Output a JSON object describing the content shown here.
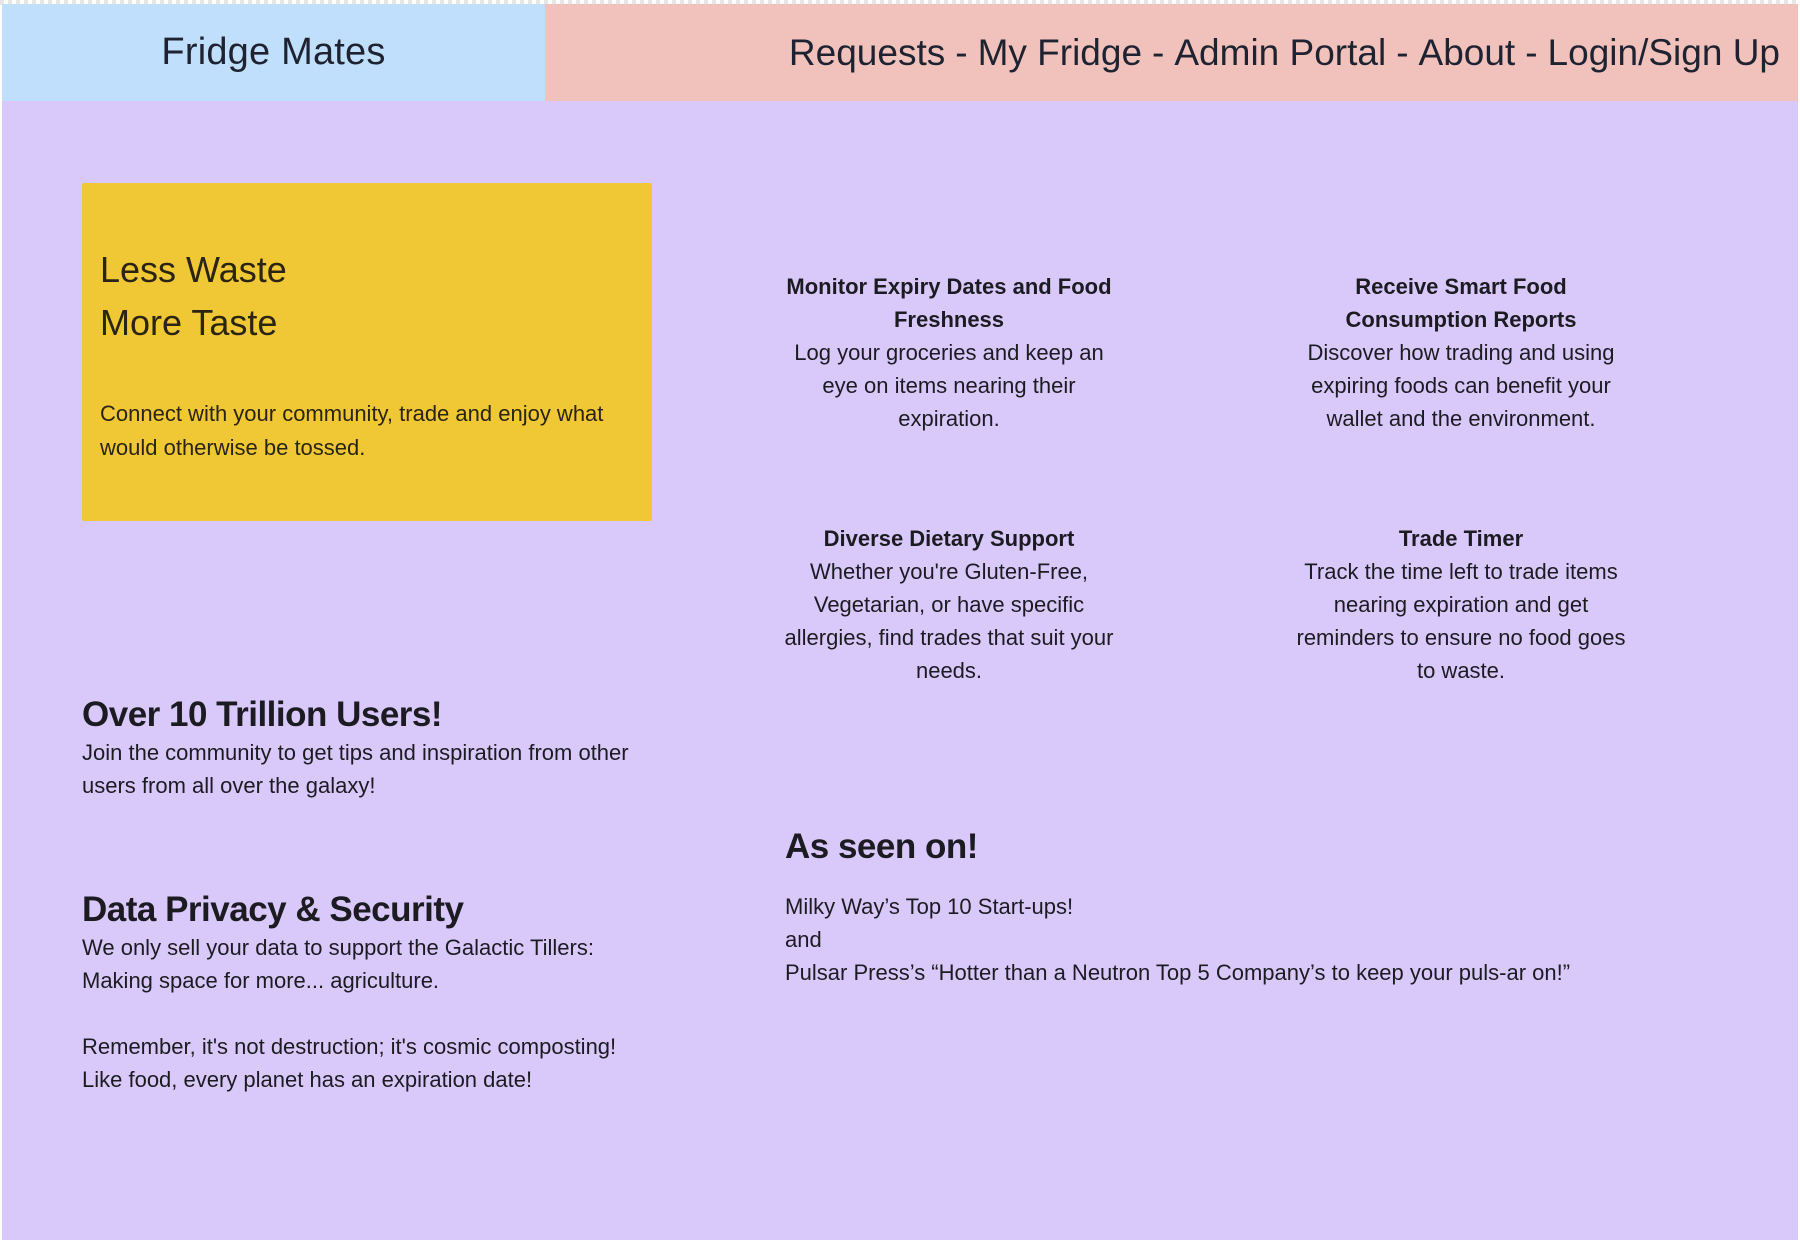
{
  "header": {
    "brand": "Fridge Mates",
    "nav": [
      {
        "label": "Requests"
      },
      {
        "label": "My Fridge"
      },
      {
        "label": "Admin Portal"
      },
      {
        "label": "About"
      },
      {
        "label": "Login/Sign Up"
      }
    ],
    "separator": "-"
  },
  "hero": {
    "line1": "Less Waste",
    "line2": "More Taste",
    "text": "Connect with your community, trade and enjoy what would otherwise be tossed."
  },
  "features": [
    {
      "title": "Monitor Expiry Dates and Food Freshness",
      "text": "Log your groceries and keep an eye on items nearing their expiration."
    },
    {
      "title": "Receive Smart Food Consumption Reports",
      "text": "Discover how trading and using expiring foods can benefit your wallet and the environment."
    },
    {
      "title": "Diverse Dietary Support",
      "text": "Whether you're Gluten-Free, Vegetarian, or have specific allergies, find trades that suit your needs."
    },
    {
      "title": "Trade Timer",
      "text": "Track the time left to trade items nearing expiration and get reminders to ensure no food goes to waste."
    }
  ],
  "users": {
    "heading": "Over 10 Trillion Users!",
    "text": "Join the community to get tips and inspiration from other users from all over the galaxy!"
  },
  "privacy": {
    "heading": "Data Privacy & Security",
    "line1": "We only sell your data to support the Galactic Tillers:",
    "line2": "Making space for more... agriculture.",
    "line3": "Remember, it's not destruction; it's cosmic composting!",
    "line4": "Like food, every planet has an expiration date!"
  },
  "seen_on": {
    "heading": "As seen on!",
    "item1": "Milky Way’s Top 10 Start-ups!",
    "conjunction": "and",
    "item2": "Pulsar Press’s “Hotter than a Neutron Top 5 Company’s to keep your puls-ar on!”"
  },
  "colors": {
    "background": "#d9c9fb",
    "brand_bar": "#bfdffd",
    "nav_bar": "#f0c2bb",
    "hero_card": "#f0c836"
  }
}
